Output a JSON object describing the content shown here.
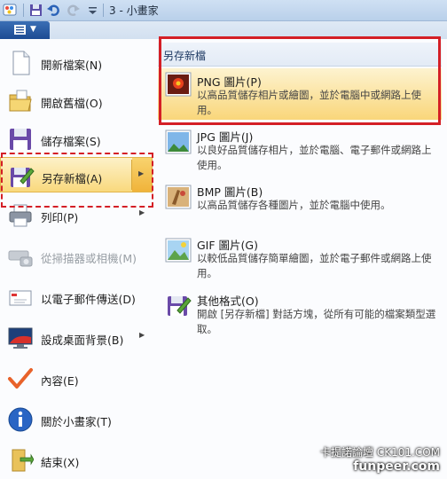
{
  "window": {
    "title": "3 - 小畫家"
  },
  "left_menu": [
    {
      "label": "開新檔案(N)",
      "icon": "new-file-icon",
      "arrow": false,
      "disabled": false
    },
    {
      "label": "開啟舊檔(O)",
      "icon": "open-folder-icon",
      "arrow": false,
      "disabled": false
    },
    {
      "label": "儲存檔案(S)",
      "icon": "save-disk-icon",
      "arrow": false,
      "disabled": false
    },
    {
      "label": "另存新檔(A)",
      "icon": "save-as-icon",
      "arrow": true,
      "disabled": false,
      "selected": true
    },
    {
      "label": "列印(P)",
      "icon": "printer-icon",
      "arrow": true,
      "disabled": false
    },
    {
      "label": "從掃描器或相機(M)",
      "icon": "scanner-camera-icon",
      "arrow": false,
      "disabled": true
    },
    {
      "label": "以電子郵件傳送(D)",
      "icon": "email-icon",
      "arrow": false,
      "disabled": false
    },
    {
      "label": "設成桌面背景(B)",
      "icon": "desktop-background-icon",
      "arrow": true,
      "disabled": false
    },
    {
      "label": "內容(E)",
      "icon": "checkmark-icon",
      "arrow": false,
      "disabled": false
    },
    {
      "label": "關於小畫家(T)",
      "icon": "info-icon",
      "arrow": false,
      "disabled": false
    },
    {
      "label": "結束(X)",
      "icon": "exit-icon",
      "arrow": false,
      "disabled": false
    }
  ],
  "submenu": {
    "header": "另存新檔",
    "items": [
      {
        "title": "PNG 圖片(P)",
        "icon": "png-image-icon",
        "desc": "以高品質儲存相片或繪圖，並於電腦中或網路上使用。",
        "selected": true
      },
      {
        "title": "JPG 圖片(J)",
        "icon": "jpg-image-icon",
        "desc": "以良好品質儲存相片，並於電腦、電子郵件或網路上使用。"
      },
      {
        "title": "BMP 圖片(B)",
        "icon": "bmp-image-icon",
        "desc": "以高品質儲存各種圖片，並於電腦中使用。"
      },
      {
        "title": "GIF 圖片(G)",
        "icon": "gif-image-icon",
        "desc": "以較低品質儲存簡單繪圖，並於電子郵件或網路上使用。"
      },
      {
        "title": "其他格式(O)",
        "icon": "other-formats-icon",
        "desc": "開啟 [另存新檔] 對話方塊，從所有可能的檔案類型選取。"
      }
    ]
  },
  "watermark": {
    "line1": "卡提諾論壇 CK101.COM",
    "line2": "funpeer.com"
  },
  "colors": {
    "highlight_outline": "#d41f26",
    "selected_fill": "#f9d97d",
    "app_button": "#1c4b93"
  }
}
